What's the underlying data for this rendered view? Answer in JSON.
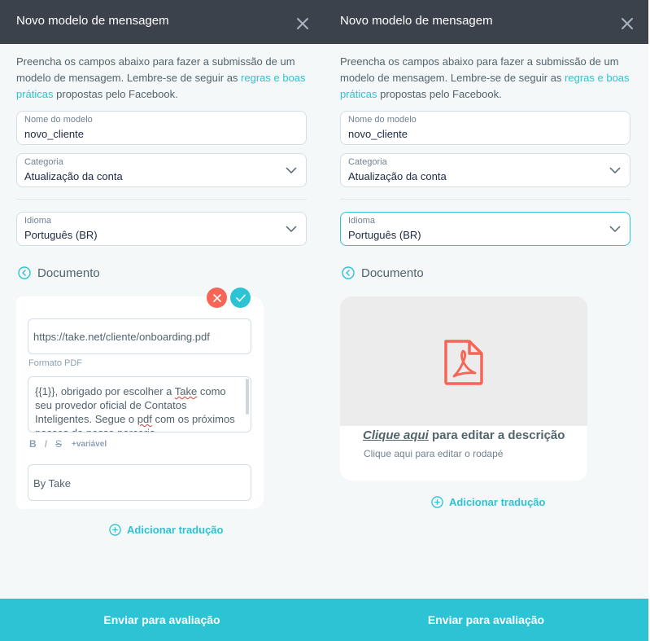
{
  "colors": {
    "header_bg": "#3b424b",
    "panel_bg": "#f5f8f9",
    "accent": "#2cc3d5",
    "danger": "#f76556",
    "pdf_icon": "#f76556"
  },
  "left": {
    "header": {
      "title": "Novo modelo de mensagem",
      "close_icon": "close-icon"
    },
    "intro": {
      "text_before": "Preencha os campos abaixo para fazer a submissão de um modelo de mensagem. Lembre-se de seguir as ",
      "link": "regras e boas práticas",
      "text_after": " propostas pelo Facebook."
    },
    "model_name": {
      "label": "Nome do modelo",
      "value": "novo_cliente"
    },
    "category": {
      "label": "Categoria",
      "value": "Atualização da conta"
    },
    "language": {
      "label": "Idioma",
      "value": "Português (BR)"
    },
    "document": {
      "title": "Documento"
    },
    "edit": {
      "url": "https://take.net/cliente/onboarding.pdf",
      "format_label": "Formato PDF",
      "body_part1": "{{1}}, obrigado por escolher a ",
      "body_take": "Take",
      "body_part2": " como seu provedor oficial de Contatos Inteligentes. Segue o ",
      "body_pdf": "pdf",
      "body_part3": " com os próximos passos da nossa parceria",
      "toolbar": {
        "bold": "B",
        "italic": "I",
        "strike": "S",
        "variable": "+variável"
      },
      "footer": "By Take"
    },
    "add_translation": "Adicionar tradução",
    "submit": "Enviar para avaliação"
  },
  "right": {
    "header": {
      "title": "Novo modelo de mensagem",
      "close_icon": "close-icon"
    },
    "intro": {
      "text_before": "Preencha os campos abaixo para fazer a submissão de um modelo de mensagem. Lembre-se de seguir as ",
      "link": "regras e boas práticas",
      "text_after": " propostas pelo Facebook."
    },
    "model_name": {
      "label": "Nome do modelo",
      "value": "novo_cliente"
    },
    "category": {
      "label": "Categoria",
      "value": "Atualização da conta"
    },
    "language": {
      "label": "Idioma",
      "value": "Português (BR)"
    },
    "document": {
      "title": "Documento"
    },
    "preview": {
      "media_icon": "pdf-icon",
      "description_link": "Clique aqui",
      "description_rest": " para editar a descrição",
      "footer_hint": "Clique aqui para editar o rodapé"
    },
    "add_translation": "Adicionar tradução",
    "submit": "Enviar para avaliação"
  }
}
